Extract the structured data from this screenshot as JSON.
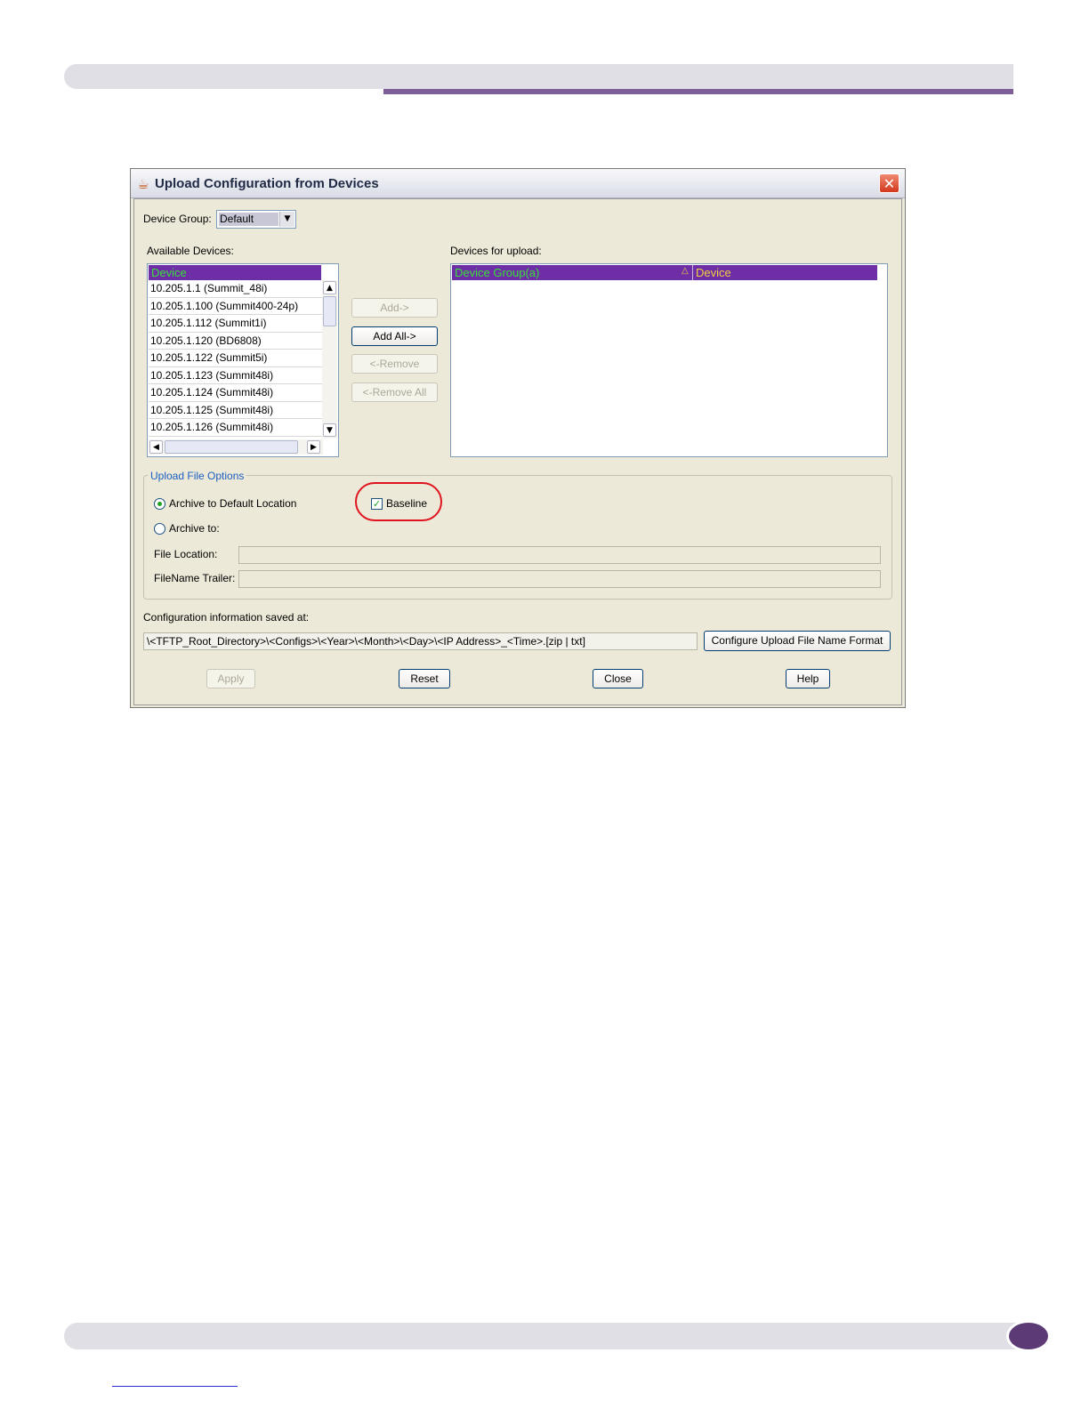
{
  "dialog": {
    "title": "Upload Configuration from Devices",
    "close_glyph": "✕"
  },
  "device_group": {
    "label": "Device Group:",
    "value": "Default"
  },
  "available": {
    "label": "Available Devices:",
    "column": "Device",
    "rows": [
      "10.205.1.1 (Summit_48i)",
      "10.205.1.100 (Summit400-24p)",
      "10.205.1.112 (Summit1i)",
      "10.205.1.120 (BD6808)",
      "10.205.1.122 (Summit5i)",
      "10.205.1.123 (Summit48i)",
      "10.205.1.124 (Summit48i)",
      "10.205.1.125 (Summit48i)",
      "10.205.1.126 (Summit48i)"
    ]
  },
  "transfer": {
    "add": "Add->",
    "add_all": "Add All->",
    "remove": "<-Remove",
    "remove_all": "<-Remove All"
  },
  "upload": {
    "label": "Devices for upload:",
    "col_group": "Device Group(a)",
    "sort_glyph": "△",
    "col_device": "Device"
  },
  "options": {
    "title": "Upload File Options",
    "archive_default": "Archive to Default Location",
    "archive_default_selected": true,
    "baseline": "Baseline",
    "baseline_checked": true,
    "archive_to": "Archive to:",
    "archive_to_selected": false,
    "file_location_label": "File Location:",
    "file_location_value": "",
    "filename_trailer_label": "FileName Trailer:",
    "filename_trailer_value": ""
  },
  "saved": {
    "label": "Configuration information saved at:",
    "path": "\\<TFTP_Root_Directory>\\<Configs>\\<Year>\\<Month>\\<Day>\\<IP Address>_<Time>.[zip | txt]",
    "configure_button": "Configure Upload File Name Format"
  },
  "buttons": {
    "apply": "Apply",
    "reset": "Reset",
    "close": "Close",
    "help": "Help"
  },
  "colors": {
    "header_bg": "#6e2ea6",
    "header_green": "#38e038",
    "header_yellow": "#f0d040",
    "highlight_red": "#e0141e",
    "page_band": "#e1dfe6",
    "page_accent": "#7d5e97"
  }
}
